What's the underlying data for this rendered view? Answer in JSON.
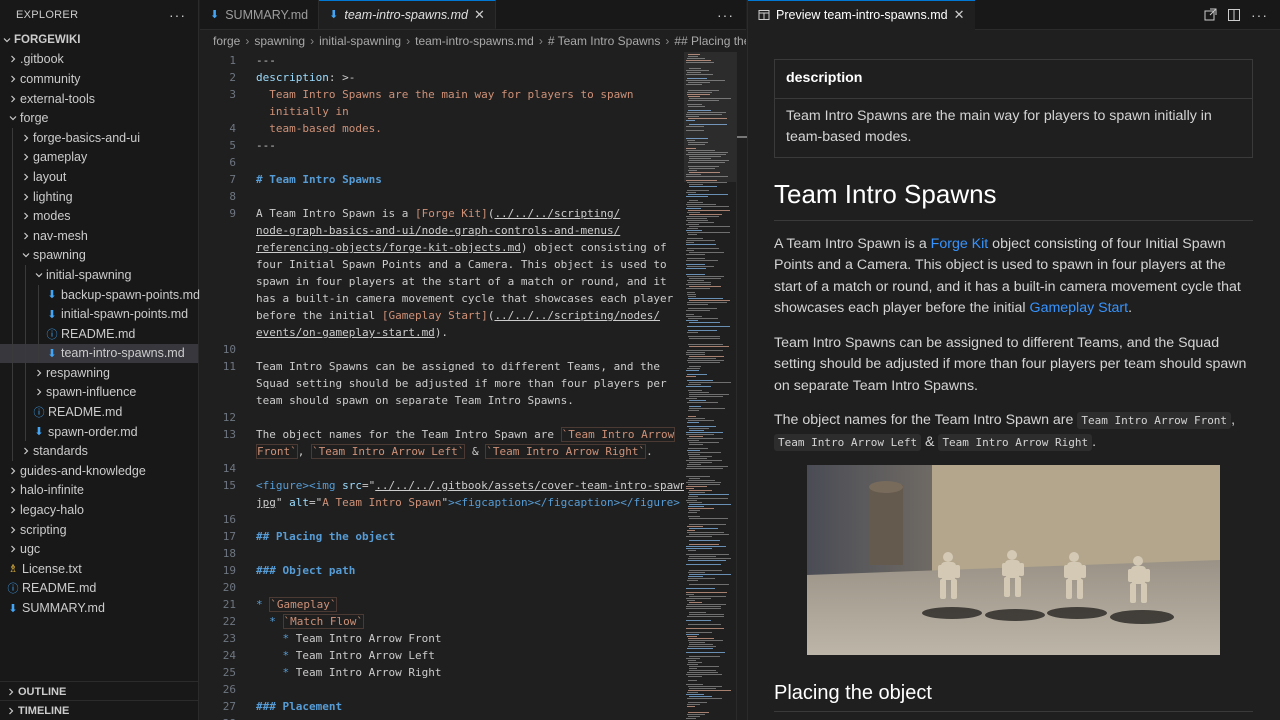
{
  "explorer": {
    "title": "EXPLORER",
    "more": "···",
    "root": "FORGEWIKI",
    "items": [
      {
        "label": ".gitbook",
        "depth": 1,
        "kind": "folder",
        "state": "closed"
      },
      {
        "label": "community",
        "depth": 1,
        "kind": "folder",
        "state": "closed"
      },
      {
        "label": "external-tools",
        "depth": 1,
        "kind": "folder",
        "state": "closed"
      },
      {
        "label": "forge",
        "depth": 1,
        "kind": "folder",
        "state": "open"
      },
      {
        "label": "forge-basics-and-ui",
        "depth": 2,
        "kind": "folder",
        "state": "closed"
      },
      {
        "label": "gameplay",
        "depth": 2,
        "kind": "folder",
        "state": "closed"
      },
      {
        "label": "layout",
        "depth": 2,
        "kind": "folder",
        "state": "closed"
      },
      {
        "label": "lighting",
        "depth": 2,
        "kind": "folder",
        "state": "closed"
      },
      {
        "label": "modes",
        "depth": 2,
        "kind": "folder",
        "state": "closed"
      },
      {
        "label": "nav-mesh",
        "depth": 2,
        "kind": "folder",
        "state": "closed"
      },
      {
        "label": "spawning",
        "depth": 2,
        "kind": "folder",
        "state": "open"
      },
      {
        "label": "initial-spawning",
        "depth": 3,
        "kind": "folder",
        "state": "open"
      },
      {
        "label": "backup-spawn-points.md",
        "depth": 4,
        "kind": "md"
      },
      {
        "label": "initial-spawn-points.md",
        "depth": 4,
        "kind": "md"
      },
      {
        "label": "README.md",
        "depth": 4,
        "kind": "info"
      },
      {
        "label": "team-intro-spawns.md",
        "depth": 4,
        "kind": "md",
        "selected": true
      },
      {
        "label": "respawning",
        "depth": 3,
        "kind": "folder",
        "state": "closed"
      },
      {
        "label": "spawn-influence",
        "depth": 3,
        "kind": "folder",
        "state": "closed"
      },
      {
        "label": "README.md",
        "depth": 3,
        "kind": "info"
      },
      {
        "label": "spawn-order.md",
        "depth": 3,
        "kind": "md"
      },
      {
        "label": "standards",
        "depth": 2,
        "kind": "folder",
        "state": "closed"
      },
      {
        "label": "guides-and-knowledge",
        "depth": 1,
        "kind": "folder",
        "state": "closed"
      },
      {
        "label": "halo-infinite",
        "depth": 1,
        "kind": "folder",
        "state": "closed"
      },
      {
        "label": "legacy-halo",
        "depth": 1,
        "kind": "folder",
        "state": "closed"
      },
      {
        "label": "scripting",
        "depth": 1,
        "kind": "folder",
        "state": "closed"
      },
      {
        "label": "ugc",
        "depth": 1,
        "kind": "folder",
        "state": "closed"
      },
      {
        "label": "License.txt",
        "depth": 1,
        "kind": "license"
      },
      {
        "label": "README.md",
        "depth": 1,
        "kind": "info"
      },
      {
        "label": "SUMMARY.md",
        "depth": 1,
        "kind": "md"
      }
    ],
    "outline": "OUTLINE",
    "timeline": "TIMELINE"
  },
  "editor": {
    "tabs": [
      {
        "label": "SUMMARY.md",
        "active": false
      },
      {
        "label": "team-intro-spawns.md",
        "active": true,
        "close": "✕"
      }
    ],
    "more": "···",
    "breadcrumb": [
      "forge",
      "spawning",
      "initial-spawning",
      "team-intro-spawns.md",
      "# Team Intro Spawns",
      "## Placing the object"
    ]
  },
  "code": {
    "lines": [
      {
        "n": "1",
        "segs": [
          [
            "c-meta",
            "---"
          ]
        ]
      },
      {
        "n": "2",
        "segs": [
          [
            "c-key",
            "description"
          ],
          [
            "c-meta",
            ": >-"
          ]
        ]
      },
      {
        "n": "3",
        "segs": [
          [
            "c-str",
            "  Team Intro Spawns are the main way for players to spawn"
          ]
        ]
      },
      {
        "n": "",
        "segs": [
          [
            "c-str",
            "  initially in"
          ]
        ]
      },
      {
        "n": "4",
        "segs": [
          [
            "c-str",
            "  team-based modes."
          ]
        ]
      },
      {
        "n": "5",
        "segs": [
          [
            "c-meta",
            "---"
          ]
        ]
      },
      {
        "n": "6",
        "segs": []
      },
      {
        "n": "7",
        "segs": [
          [
            "c-head",
            "# Team Intro Spawns"
          ]
        ]
      },
      {
        "n": "8",
        "segs": []
      },
      {
        "n": "9",
        "segs": [
          [
            "",
            "A Team Intro Spawn is a "
          ],
          [
            "c-link",
            "[Forge Kit]"
          ],
          [
            "",
            "("
          ],
          [
            "c-url",
            "../../../scripting/"
          ]
        ]
      },
      {
        "n": "",
        "segs": [
          [
            "c-url",
            "node-graph-basics-and-ui/node-graph-controls-and-menus/"
          ]
        ]
      },
      {
        "n": "",
        "segs": [
          [
            "c-url",
            "referencing-objects/forge-kit-objects.md"
          ],
          [
            "",
            ") object consisting of"
          ]
        ]
      },
      {
        "n": "",
        "segs": [
          [
            "",
            "four Initial Spawn Points and a Camera. This object is used to"
          ]
        ]
      },
      {
        "n": "",
        "segs": [
          [
            "",
            "spawn in four players at the start of a match or round, and it"
          ]
        ]
      },
      {
        "n": "",
        "segs": [
          [
            "",
            "has a built-in camera movement cycle that showcases each player"
          ]
        ]
      },
      {
        "n": "",
        "segs": [
          [
            "",
            "before the initial "
          ],
          [
            "c-link",
            "[Gameplay Start]"
          ],
          [
            "",
            "("
          ],
          [
            "c-url",
            "../../../scripting/nodes/"
          ]
        ]
      },
      {
        "n": "",
        "segs": [
          [
            "c-url",
            "events/on-gameplay-start.md"
          ],
          [
            "",
            ")."
          ]
        ]
      },
      {
        "n": "10",
        "segs": []
      },
      {
        "n": "11",
        "segs": [
          [
            "",
            "Team Intro Spawns can be assigned to different Teams, and the"
          ]
        ]
      },
      {
        "n": "",
        "segs": [
          [
            "",
            "Squad setting should be adjusted if more than four players per"
          ]
        ]
      },
      {
        "n": "",
        "segs": [
          [
            "",
            "team should spawn on separate Team Intro Spawns."
          ]
        ]
      },
      {
        "n": "12",
        "segs": []
      },
      {
        "n": "13",
        "segs": [
          [
            "",
            "The object names for the Team Intro Spawn are "
          ],
          [
            "c-tick",
            "`Team Intro Arrow"
          ]
        ]
      },
      {
        "n": "",
        "segs": [
          [
            "c-tick",
            "Front`"
          ],
          [
            "",
            ", "
          ],
          [
            "c-tick",
            "`Team Intro Arrow Left`"
          ],
          [
            "",
            " & "
          ],
          [
            "c-tick",
            "`Team Intro Arrow Right`"
          ],
          [
            "",
            "."
          ]
        ]
      },
      {
        "n": "14",
        "segs": []
      },
      {
        "n": "15",
        "segs": [
          [
            "c-tag",
            "<figure><img "
          ],
          [
            "c-attr",
            "src"
          ],
          [
            "",
            "=\""
          ],
          [
            "c-url",
            "../../../.gitbook/assets/cover-team-intro-spawn."
          ]
        ]
      },
      {
        "n": "",
        "segs": [
          [
            "c-url",
            "jpg"
          ],
          [
            "",
            "\" "
          ],
          [
            "c-attr",
            "alt"
          ],
          [
            "",
            "=\""
          ],
          [
            "c-str",
            "A Team Intro Spawn"
          ],
          [
            "",
            "\""
          ],
          [
            "c-tag",
            "><figcaption></figcaption></figure>"
          ]
        ]
      },
      {
        "n": "16",
        "segs": []
      },
      {
        "n": "17",
        "segs": [
          [
            "c-head",
            "## Placing the object"
          ]
        ]
      },
      {
        "n": "18",
        "segs": []
      },
      {
        "n": "19",
        "segs": [
          [
            "c-head",
            "### Object path"
          ]
        ]
      },
      {
        "n": "20",
        "segs": []
      },
      {
        "n": "21",
        "segs": [
          [
            "c-bullet",
            "* "
          ],
          [
            "c-tick",
            "`Gameplay`"
          ]
        ]
      },
      {
        "n": "22",
        "segs": [
          [
            "c-bullet",
            "  * "
          ],
          [
            "c-tick",
            "`Match Flow`"
          ]
        ]
      },
      {
        "n": "23",
        "segs": [
          [
            "c-bullet",
            "    * "
          ],
          [
            "",
            "Team Intro Arrow Front"
          ]
        ]
      },
      {
        "n": "24",
        "segs": [
          [
            "c-bullet",
            "    * "
          ],
          [
            "",
            "Team Intro Arrow Left"
          ]
        ]
      },
      {
        "n": "25",
        "segs": [
          [
            "c-bullet",
            "    * "
          ],
          [
            "",
            "Team Intro Arrow Right"
          ]
        ]
      },
      {
        "n": "26",
        "segs": []
      },
      {
        "n": "27",
        "segs": [
          [
            "c-head",
            "### Placement"
          ]
        ]
      },
      {
        "n": "28",
        "segs": []
      }
    ]
  },
  "preview": {
    "tab_label": "Preview team-intro-spawns.md",
    "close": "✕",
    "meta_header": "description",
    "meta_value": "Team Intro Spawns are the main way for players to spawn initially in team-based modes.",
    "h1": "Team Intro Spawns",
    "p1_a": "A Team Intro Spawn is a ",
    "p1_link1": "Forge Kit",
    "p1_b": " object consisting of four Initial Spawn Points and a Camera. This object is used to spawn in four players at the start of a match or round, and it has a built-in camera movement cycle that showcases each player before the initial ",
    "p1_link2": "Gameplay Start",
    "p1_c": ".",
    "p2": "Team Intro Spawns can be assigned to different Teams, and the Squad setting should be adjusted if more than four players per team should spawn on separate Team Intro Spawns.",
    "p3_a": "The object names for the Team Intro Spawn are ",
    "p3_code1": "Team Intro Arrow Front",
    "p3_b": ", ",
    "p3_code2": "Team Intro Arrow Left",
    "p3_c": " & ",
    "p3_code3": "Team Intro Arrow Right",
    "p3_d": ".",
    "h2": "Placing the object"
  }
}
